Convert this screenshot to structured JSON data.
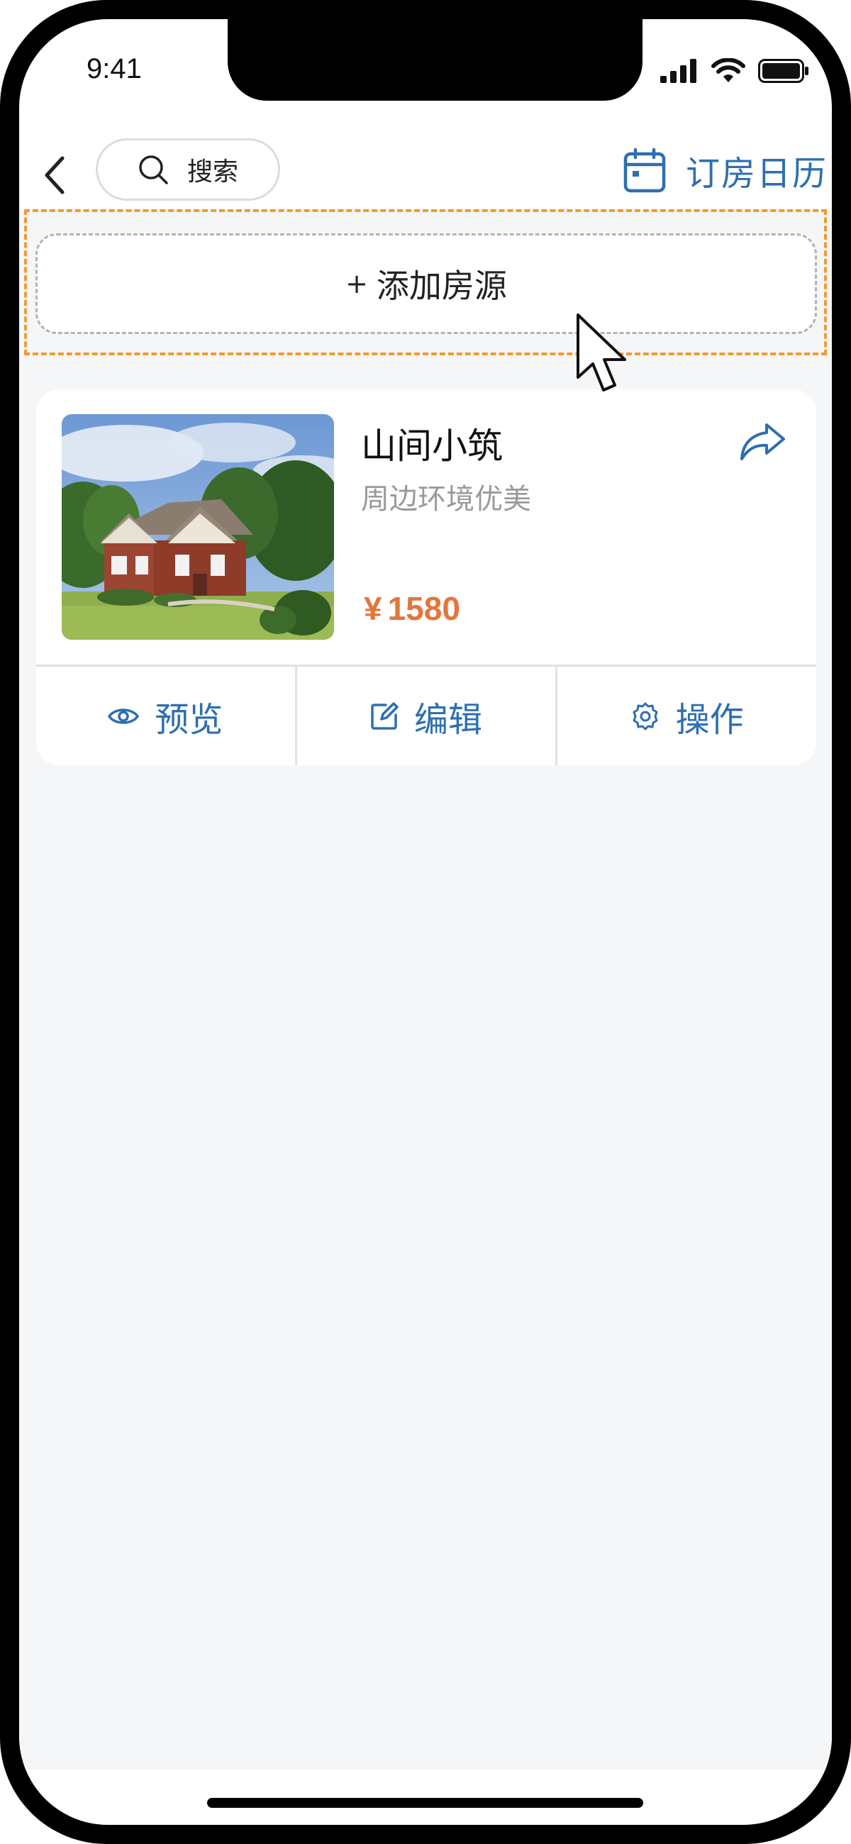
{
  "status_bar": {
    "time": "9:41"
  },
  "nav": {
    "search_label": "搜索",
    "calendar_label": "订房日历"
  },
  "add_listing": {
    "plus": "+",
    "label": "添加房源"
  },
  "listing": {
    "title": "山间小筑",
    "subtitle": "周边环境优美",
    "currency": "¥",
    "price": "1580",
    "actions": {
      "preview": "预览",
      "edit": "编辑",
      "operate": "操作"
    }
  },
  "colors": {
    "accent_blue": "#2d6fb0",
    "price_orange": "#e4763a",
    "highlight_orange": "#f39a2e",
    "background": "#f4f6f8"
  },
  "icons": [
    "back-icon",
    "search-icon",
    "calendar-icon",
    "share-icon",
    "eye-icon",
    "edit-icon",
    "gear-icon",
    "signal-icon",
    "wifi-icon",
    "battery-icon",
    "cursor-icon"
  ]
}
